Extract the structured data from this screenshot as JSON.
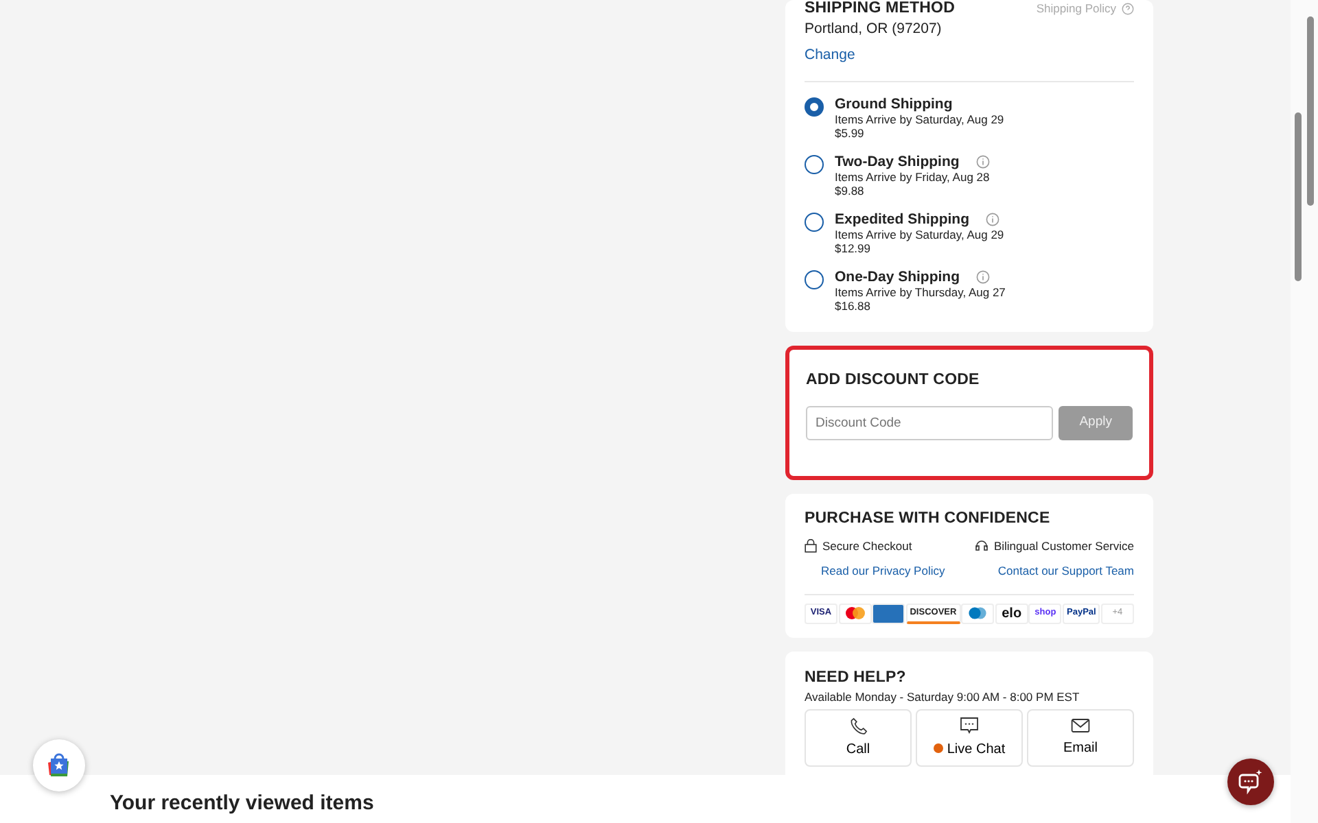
{
  "shipping": {
    "title": "SHIPPING METHOD",
    "policy_link": "Shipping Policy",
    "location": "Portland, OR (97207)",
    "change_link": "Change",
    "options": [
      {
        "name": "Ground Shipping",
        "arrival": "Items Arrive by Saturday, Aug 29",
        "price": "$5.99",
        "selected": true,
        "info": false
      },
      {
        "name": "Two-Day Shipping",
        "arrival": "Items Arrive by Friday, Aug 28",
        "price": "$9.88",
        "selected": false,
        "info": true
      },
      {
        "name": "Expedited Shipping",
        "arrival": "Items Arrive by Saturday, Aug 29",
        "price": "$12.99",
        "selected": false,
        "info": true
      },
      {
        "name": "One-Day Shipping",
        "arrival": "Items Arrive by Thursday, Aug 27",
        "price": "$16.88",
        "selected": false,
        "info": true
      }
    ]
  },
  "discount": {
    "title": "ADD DISCOUNT CODE",
    "placeholder": "Discount Code",
    "button": "Apply",
    "highlighted": true,
    "button_disabled": true
  },
  "confidence": {
    "title": "PURCHASE WITH CONFIDENCE",
    "features": [
      {
        "kind": "lock",
        "label": "Secure Checkout",
        "link": "Read our Privacy Policy"
      },
      {
        "kind": "headset",
        "label": "Bilingual Customer Service",
        "link": "Contact our Support Team"
      }
    ],
    "payment_methods": [
      {
        "kind": "visa",
        "label": "VISA"
      },
      {
        "kind": "mastercard"
      },
      {
        "kind": "amex"
      },
      {
        "kind": "discover",
        "label": "DISCOVER"
      },
      {
        "kind": "diners"
      },
      {
        "kind": "elo",
        "label": "elo"
      },
      {
        "kind": "shop",
        "label": "shop"
      },
      {
        "kind": "paypal",
        "label": "PayPal"
      },
      {
        "kind": "more",
        "label": "+4"
      }
    ]
  },
  "help": {
    "title": "NEED HELP?",
    "hours": "Available Monday - Saturday 9:00 AM - 8:00 PM EST",
    "options": [
      {
        "kind": "phone",
        "label": "Call",
        "online": false
      },
      {
        "kind": "chat",
        "label": "Live Chat",
        "online": true
      },
      {
        "kind": "mail",
        "label": "Email",
        "online": false
      }
    ]
  },
  "recently_viewed": {
    "title": "Your recently viewed items"
  }
}
